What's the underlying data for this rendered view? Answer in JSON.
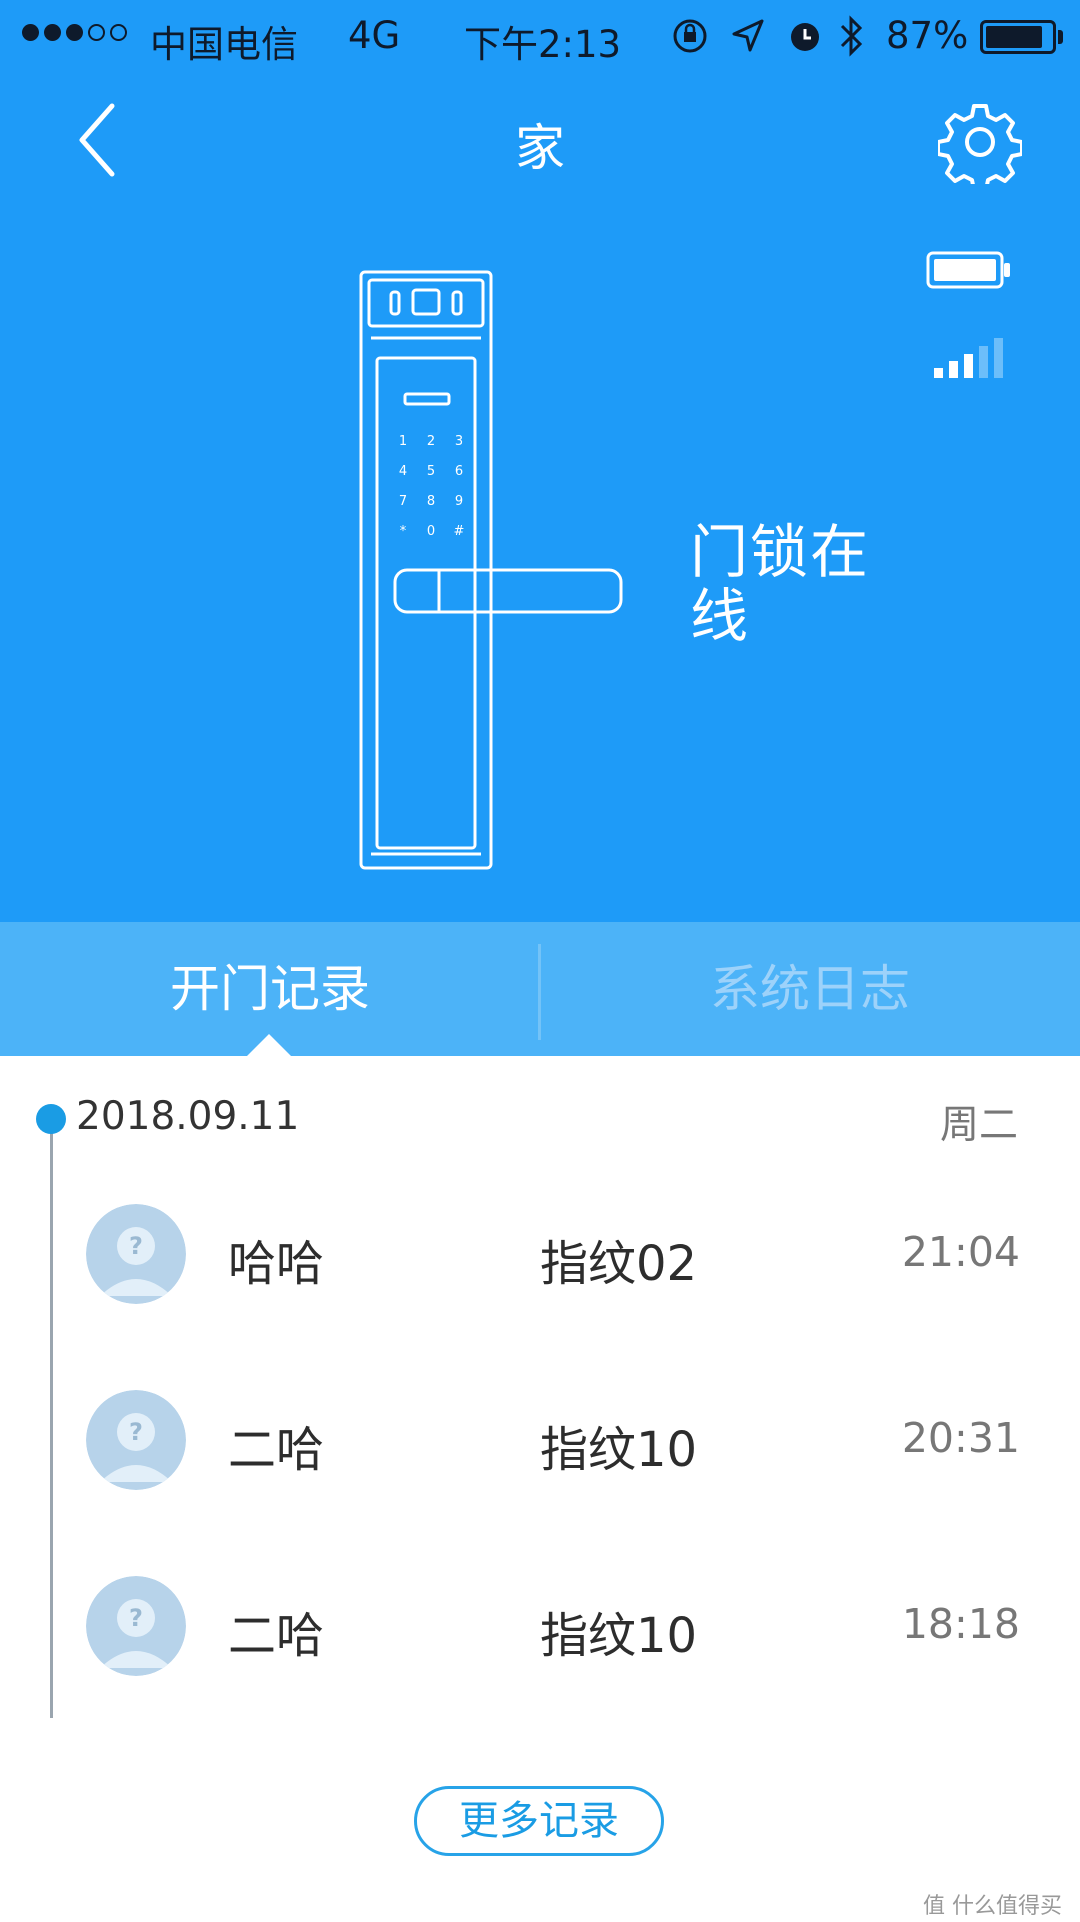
{
  "status_bar": {
    "carrier": "中国电信",
    "network": "4G",
    "time": "下午2:13",
    "battery": "87%",
    "battery_level": 0.87,
    "signal_dots_filled": 3,
    "signal_dots_total": 5
  },
  "nav": {
    "title": "家",
    "back_icon": "chevron-left-icon",
    "settings_icon": "gear-icon"
  },
  "device": {
    "status_text": "门锁在线",
    "battery_icon": "battery-icon",
    "signal_icon": "signal-bars-icon",
    "signal_bars_filled": 3,
    "signal_bars_total": 5
  },
  "tabs": {
    "items": [
      {
        "label": "开门记录",
        "active": true
      },
      {
        "label": "系统日志",
        "active": false
      }
    ]
  },
  "records": {
    "date": "2018.09.11",
    "weekday": "周二",
    "entries": [
      {
        "name": "哈哈",
        "method": "指纹02",
        "time": "21:04"
      },
      {
        "name": "二哈",
        "method": "指纹10",
        "time": "20:31"
      },
      {
        "name": "二哈",
        "method": "指纹10",
        "time": "18:18"
      }
    ],
    "more_label": "更多记录"
  },
  "watermark": "值 什么值得买",
  "colors": {
    "primary": "#1e9bf8",
    "tab_bar": "#4cb3f8",
    "accent": "#1a9ce4"
  }
}
